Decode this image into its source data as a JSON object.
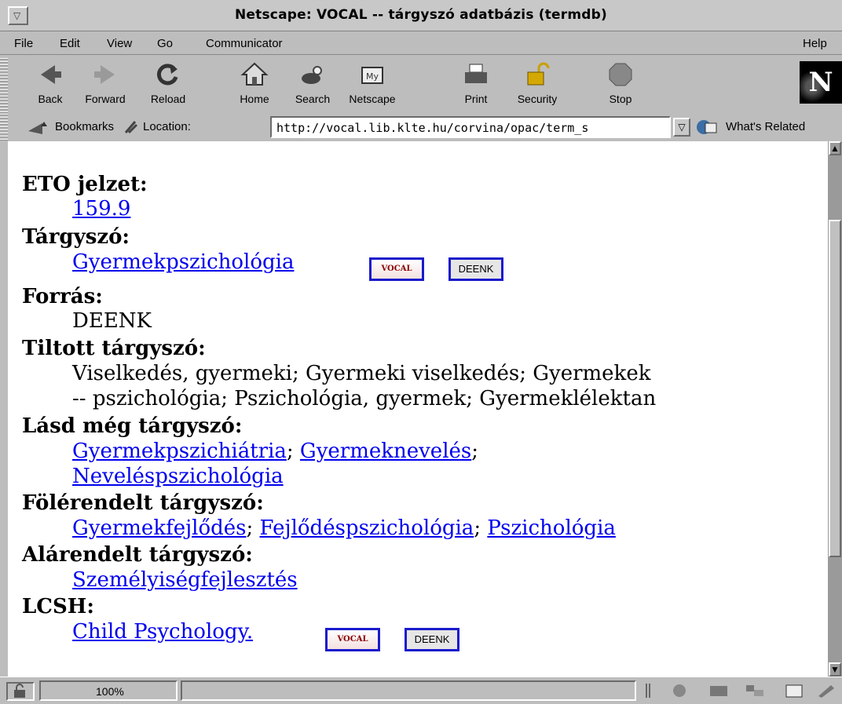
{
  "window": {
    "title": "Netscape: VOCAL -- tárgyszó adatbázis (termdb)"
  },
  "menubar": {
    "items": [
      "File",
      "Edit",
      "View",
      "Go",
      "Communicator"
    ],
    "help": "Help"
  },
  "toolbar": {
    "buttons": [
      {
        "label": "Back",
        "icon": "back-arrow-icon"
      },
      {
        "label": "Forward",
        "icon": "forward-arrow-icon"
      },
      {
        "label": "Reload",
        "icon": "reload-icon"
      },
      {
        "label": "Home",
        "icon": "home-icon"
      },
      {
        "label": "Search",
        "icon": "search-icon"
      },
      {
        "label": "Netscape",
        "icon": "netscape-icon"
      },
      {
        "label": "Print",
        "icon": "printer-icon"
      },
      {
        "label": "Security",
        "icon": "padlock-icon"
      },
      {
        "label": "Stop",
        "icon": "stop-icon"
      }
    ]
  },
  "location": {
    "bookmarks_label": "Bookmarks",
    "location_label": "Location:",
    "url": "http://vocal.lib.klte.hu/corvina/opac/term_s",
    "whats_related": "What's Related"
  },
  "record": {
    "eto": {
      "label": "ETO jelzet:",
      "value": "159.9"
    },
    "targyszo": {
      "label": "Tárgyszó:",
      "value": "Gyermekpszichológia",
      "badges": [
        "VOCAL",
        "DEENK"
      ]
    },
    "forras": {
      "label": "Forrás:",
      "value": "DEENK"
    },
    "tiltott": {
      "label": "Tiltott tárgyszó:",
      "line1": "Viselkedés, gyermeki; Gyermeki viselkedés; Gyermekek",
      "line2": "-- pszichológia; Pszichológia, gyermek; Gyermeklélektan"
    },
    "lasd_meg": {
      "label": "Lásd még tárgyszó:",
      "links": [
        "Gyermekpszichiátria",
        "Gyermeknevelés",
        "Neveléspszichológia"
      ],
      "sep": ";"
    },
    "folerendelt": {
      "label": "Fölérendelt tárgyszó:",
      "links": [
        "Gyermekfejlődés",
        "Fejlődéspszichológia",
        "Pszichológia"
      ],
      "sep": ";"
    },
    "alarendelt": {
      "label": "Alárendelt tárgyszó:",
      "links": [
        "Személyiségfejlesztés"
      ]
    },
    "lcsh": {
      "label": "LCSH:",
      "value": "Child Psychology.",
      "badges": [
        "VOCAL",
        "DEENK"
      ]
    }
  },
  "statusbar": {
    "zoom": "100%"
  }
}
